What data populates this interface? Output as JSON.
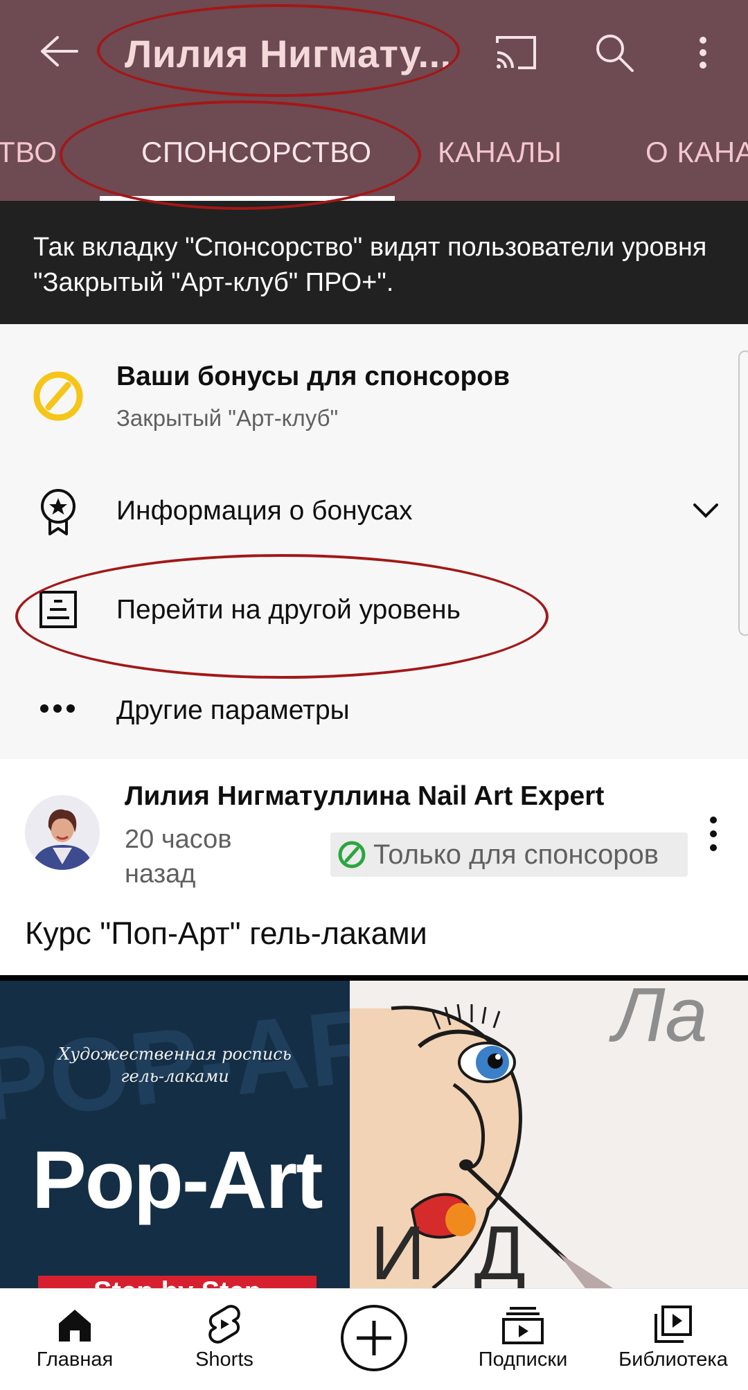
{
  "header": {
    "channel_title": "Лилия Нигмату...",
    "tabs": [
      {
        "label": "ТВО"
      },
      {
        "label": "СПОНСОРСТВО",
        "active": true
      },
      {
        "label": "КАНАЛЫ"
      },
      {
        "label": "О КАНА"
      }
    ],
    "icons": [
      "back-arrow-icon",
      "cast-icon",
      "search-icon",
      "more-vert-icon"
    ],
    "background": "#6e4a52"
  },
  "notice": {
    "text": "Так вкладку \"Спонсорство\" видят пользователи уровня \"Закрытый \"Арт-клуб\" ПРО+\"."
  },
  "membership": {
    "title": "Ваши бонусы для спонсоров",
    "level": "Закрытый \"Арт-клуб\"",
    "rows": [
      {
        "label": "Информация о бонусах",
        "icon": "badge-star-icon"
      },
      {
        "label": "Перейти на другой уровень",
        "icon": "level-list-icon"
      },
      {
        "label": "Другие параметры",
        "icon": "more-horiz-icon"
      }
    ],
    "accent": "#f5c518"
  },
  "post": {
    "author": "Лилия Нигматуллина Nail Art Expert",
    "time": "20 часов назад",
    "badge": "Только для спонсоров",
    "badge_color": "#2ba640",
    "text": "Курс \"Поп-Арт\" гель-лаками",
    "image": {
      "subtitle_line1": "Художественная роспись",
      "subtitle_line2": "гель-лаками",
      "title": "Pop-Art",
      "banner": "Step by Step",
      "bg_text": "POP-ART",
      "side_letters_top": "Ла",
      "side_letters_bottom": "И Д"
    }
  },
  "bottom_nav": {
    "items": [
      {
        "label": "Главная",
        "icon": "home-icon"
      },
      {
        "label": "Shorts",
        "icon": "shorts-icon"
      },
      {
        "label": "",
        "icon": "create-plus-icon"
      },
      {
        "label": "Подписки",
        "icon": "subscriptions-icon"
      },
      {
        "label": "Библиотека",
        "icon": "library-icon"
      }
    ]
  }
}
